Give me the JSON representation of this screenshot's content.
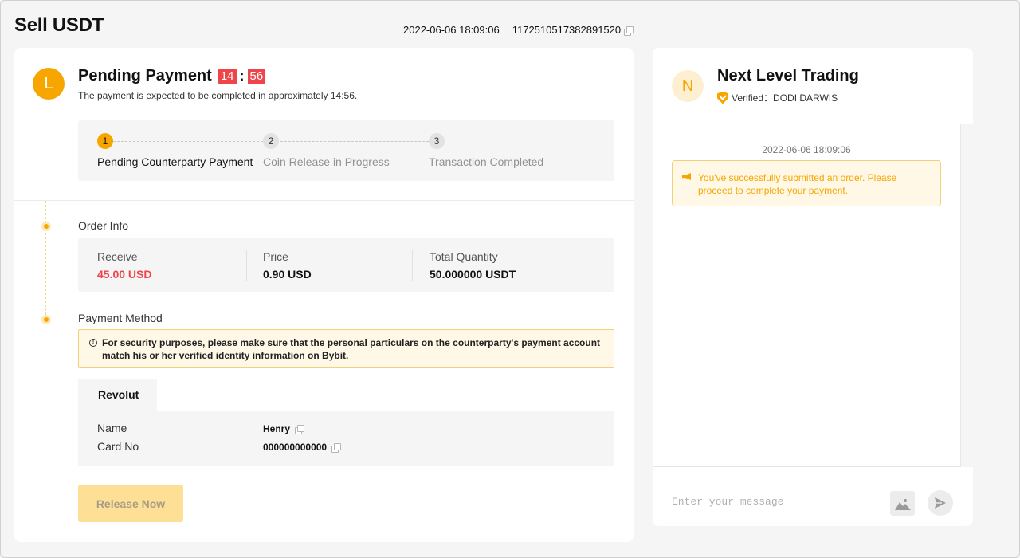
{
  "header": {
    "title": "Sell USDT",
    "datetime": "2022-06-06 18:09:06",
    "order_id": "1172510517382891520"
  },
  "status": {
    "avatar_letter": "L",
    "title": "Pending Payment",
    "timer_minutes": "14",
    "timer_separator": ":",
    "timer_seconds": "56",
    "subtitle": "The payment is expected to be completed in approximately 14:56."
  },
  "steps": [
    {
      "num": "1",
      "label": "Pending Counterparty Payment",
      "active": true
    },
    {
      "num": "2",
      "label": "Coin Release in Progress",
      "active": false
    },
    {
      "num": "3",
      "label": "Transaction Completed",
      "active": false
    }
  ],
  "order_info": {
    "section_label": "Order Info",
    "receive_label": "Receive",
    "receive_value": "45.00 USD",
    "price_label": "Price",
    "price_value": "0.90 USD",
    "quantity_label": "Total Quantity",
    "quantity_value": "50.000000 USDT"
  },
  "payment_method": {
    "section_label": "Payment Method",
    "warning": "For security purposes, please make sure that the personal particulars on the counterparty's payment account match his or her verified identity information on Bybit.",
    "tab_label": "Revolut",
    "name_label": "Name",
    "name_value": "Henry",
    "card_label": "Card No",
    "card_value": "000000000000"
  },
  "actions": {
    "release_label": "Release Now"
  },
  "chat": {
    "avatar_letter": "N",
    "merchant_name": "Next Level Trading",
    "verified_text": "Verified：DODI DARWIS",
    "message_time": "2022-06-06 18:09:06",
    "system_message": "You've successfully submitted an order. Please proceed to complete your payment.",
    "input_placeholder": "Enter your message"
  },
  "colors": {
    "accent": "#f7a600",
    "danger": "#ef454a"
  },
  "icons": [
    "copy-icon",
    "info-icon",
    "shield-icon",
    "megaphone-icon",
    "image-icon",
    "send-icon"
  ]
}
